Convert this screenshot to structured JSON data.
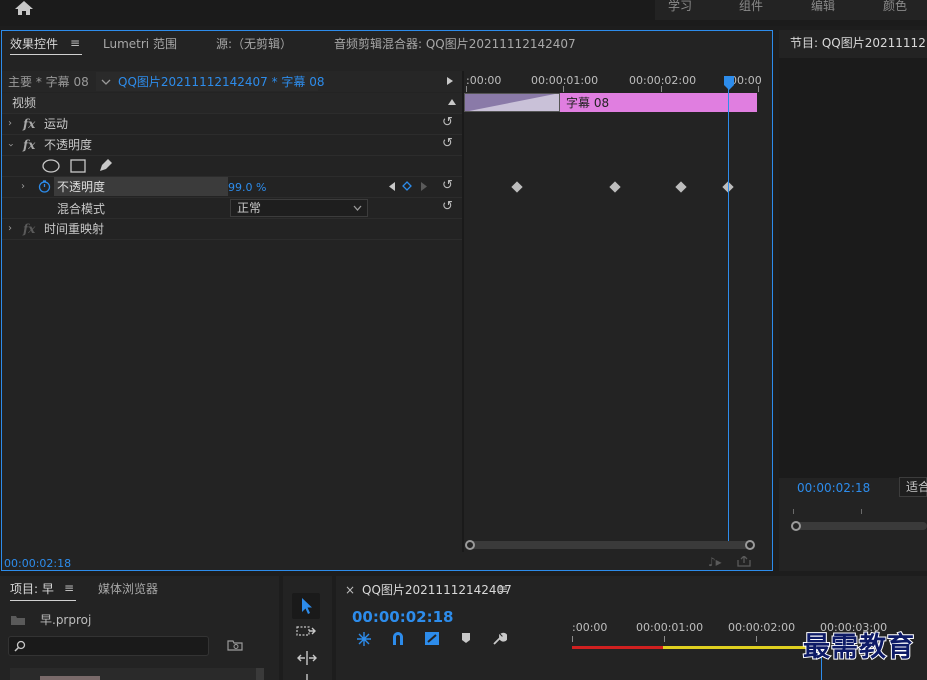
{
  "workspace_tabs": [
    "学习",
    "组件",
    "编辑",
    "颜色"
  ],
  "effects_panel": {
    "tabs": [
      "效果控件",
      "Lumetri 范围",
      "源:（无剪辑）",
      "音频剪辑混合器: QQ图片20211112142407"
    ],
    "menu_glyph": "≡",
    "clip_path_master": "主要 * 字幕 08",
    "clip_path_sequence": "QQ图片20211112142407 * 字幕 08",
    "section_video": "视频",
    "fx_label": "fx",
    "effects": {
      "motion": "运动",
      "opacity_group": "不透明度",
      "opacity_param": "不透明度",
      "opacity_value": "99.0 %",
      "blend_mode_label": "混合模式",
      "blend_mode_value": "正常",
      "time_remap": "时间重映射"
    },
    "ruler_labels": [
      ":00:00",
      "00:00:01:00",
      "00:00:02:00",
      "00:00"
    ],
    "clip_name": "字幕 08",
    "current_time": "00:00:02:18"
  },
  "program_monitor": {
    "title": "节目: QQ图片2021111214",
    "timecode": "00:00:02:18",
    "fit": "适合"
  },
  "project_panel": {
    "tabs": [
      "项目: 早",
      "媒体浏览器"
    ],
    "menu_glyph": "≡",
    "file_name": "早.prproj",
    "search_placeholder": ""
  },
  "timeline": {
    "sequence_name": "QQ图片20211112142407",
    "menu_glyph": "≡",
    "close_glyph": "×",
    "timecode": "00:00:02:18",
    "ruler_labels": [
      ":00:00",
      "00:00:01:00",
      "00:00:02:00",
      "00:00:03:00"
    ]
  },
  "watermark": "最需教育",
  "colors": {
    "accent": "#2d8ceb",
    "clip": "#e07ee0",
    "work_area_red": "#d02020",
    "work_area_yellow": "#e0d020"
  }
}
